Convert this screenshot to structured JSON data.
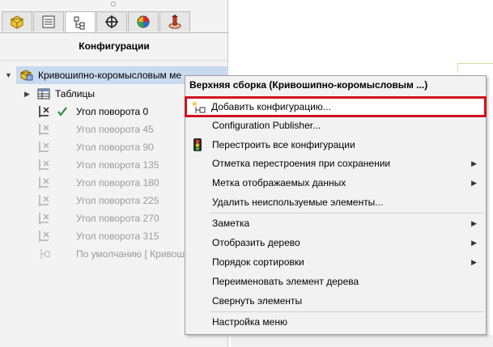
{
  "panel": {
    "title": "Конфигурации",
    "tabs": [
      "feature-manager",
      "property-manager",
      "configuration-manager",
      "dimxpert-manager",
      "display-manager",
      "cam-manager"
    ],
    "root_label": "Кривошипно-коромысловым ме",
    "tables_label": "Таблицы",
    "configs": [
      {
        "label": "Угол поворота 0",
        "active": true
      },
      {
        "label": "Угол поворота 45",
        "active": false
      },
      {
        "label": "Угол поворота 90",
        "active": false
      },
      {
        "label": "Угол поворота 135",
        "active": false
      },
      {
        "label": "Угол поворота 180",
        "active": false
      },
      {
        "label": "Угол поворота 225",
        "active": false
      },
      {
        "label": "Угол поворота 270",
        "active": false
      },
      {
        "label": "Угол поворота 315",
        "active": false
      },
      {
        "label": "По умолчанию [ Кривош",
        "active": false
      }
    ]
  },
  "menu": {
    "header": "Верхняя сборка (Кривошипно-коромысловым ...)",
    "items": [
      {
        "label": "Добавить конфигурацию...",
        "icon": "add-configuration-icon"
      },
      {
        "label": "Configuration Publisher...",
        "icon": ""
      },
      {
        "label": "Перестроить все конфигурации",
        "icon": "rebuild-icon"
      },
      {
        "label": "Отметка перестроения при сохранении",
        "submenu": true
      },
      {
        "label": "Метка отображаемых данных",
        "submenu": true
      },
      {
        "label": "Удалить неиспользуемые элементы..."
      },
      {
        "label": "Заметка",
        "submenu": true
      },
      {
        "label": "Отобразить дерево",
        "submenu": true
      },
      {
        "label": "Порядок сортировки",
        "submenu": true
      },
      {
        "label": "Переименовать элемент дерева"
      },
      {
        "label": "Свернуть элементы"
      },
      {
        "label": "Настройка меню"
      }
    ]
  },
  "colors": {
    "selection": "#c9d9ee",
    "highlight_border": "#d0121c",
    "check": "#2e8b2e"
  }
}
